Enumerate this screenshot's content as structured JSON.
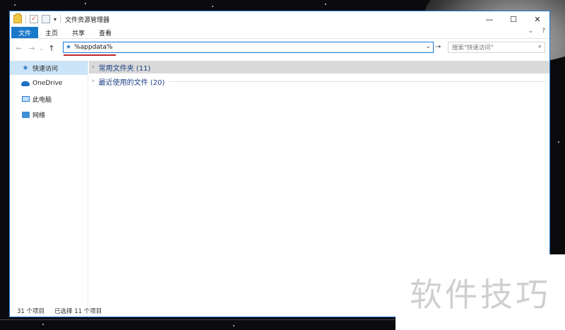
{
  "window": {
    "title": "文件资源管理器",
    "controls": {
      "minimize": "—",
      "maximize": "☐",
      "close": "✕"
    }
  },
  "ribbon": {
    "tabs": [
      "文件",
      "主页",
      "共享",
      "查看"
    ],
    "expand_glyph": "⌄",
    "help_glyph": "?"
  },
  "nav": {
    "address_value": "%appdata%",
    "search_placeholder": "搜索\"快速访问\""
  },
  "sidebar": {
    "items": [
      {
        "label": "快速访问",
        "icon": "pin-star-icon",
        "selected": true
      },
      {
        "label": "OneDrive",
        "icon": "cloud-icon",
        "selected": false
      },
      {
        "label": "此电脑",
        "icon": "pc-icon",
        "selected": false
      },
      {
        "label": "网络",
        "icon": "network-icon",
        "selected": false
      }
    ]
  },
  "content": {
    "groups": [
      {
        "label": "常用文件夹 (11)",
        "active": true
      },
      {
        "label": "最近使用的文件 (20)",
        "active": false
      }
    ]
  },
  "status": {
    "item_count": "31 个项目",
    "selected_count": "已选择 11 个项目"
  },
  "watermark": "软件技巧",
  "colors": {
    "accent": "#1979ca",
    "address_underline": "#c0262a",
    "sidebar_selected": "#cce4f7",
    "group_text": "#1b3e84"
  }
}
